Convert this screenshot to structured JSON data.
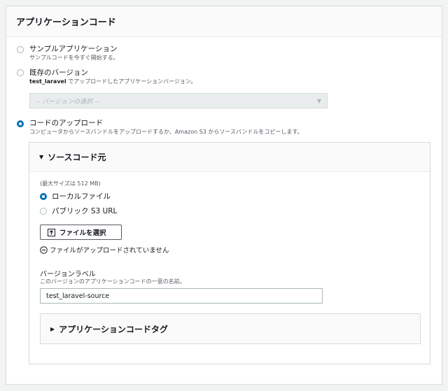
{
  "panel": {
    "title": "アプリケーションコード"
  },
  "options": [
    {
      "label": "サンプルアプリケーション",
      "desc": "サンプルコードを今すぐ開始する。",
      "selected": false
    },
    {
      "label": "既存のバージョン",
      "desc_bold": "test_laravel",
      "desc": " でアップロードしたアプリケーションバージョン。",
      "selected": false
    },
    {
      "label": "コードのアップロード",
      "desc": "コンピュータからソースバンドルをアップロードするか、Amazon S3 からソースバンドルをコピーします。",
      "selected": true
    }
  ],
  "version_select": {
    "placeholder": "-- バージョンの選択 --",
    "arrow_icon": "caret-down-icon"
  },
  "source": {
    "title": "ソースコード元",
    "max_size": "(最大サイズは 512 MB)",
    "local_file_label": "ローカルファイル",
    "s3_label": "パブリック S3 URL",
    "local_selected": true,
    "choose_file_label": "ファイルを選択",
    "no_file_text": "ファイルがアップロードされていません",
    "version_label_title": "バージョンラベル",
    "version_label_desc": "このバージョンのアプリケーションコードの一意の名前。",
    "version_label_value": "test_laravel-source",
    "tags_title": "アプリケーションコードタグ"
  },
  "colors": {
    "accent": "#0073bb",
    "border": "#d5dbdb",
    "background": "#f2f3f3"
  }
}
